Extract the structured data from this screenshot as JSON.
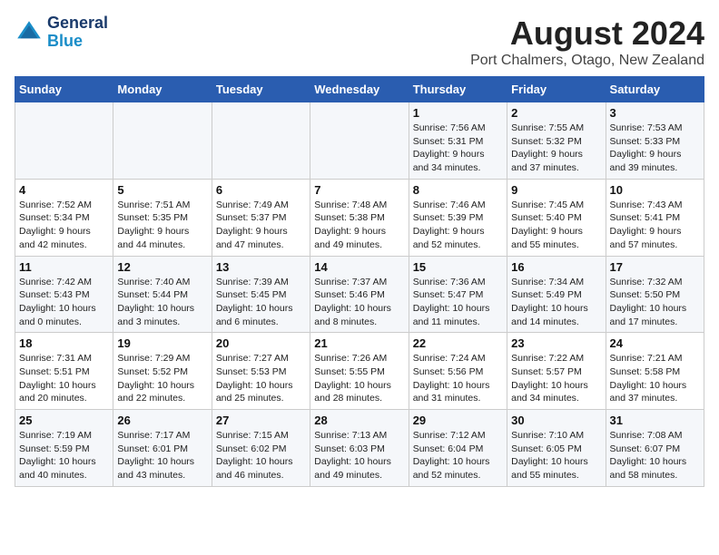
{
  "header": {
    "logo_line1": "General",
    "logo_line2": "Blue",
    "month_year": "August 2024",
    "location": "Port Chalmers, Otago, New Zealand"
  },
  "weekdays": [
    "Sunday",
    "Monday",
    "Tuesday",
    "Wednesday",
    "Thursday",
    "Friday",
    "Saturday"
  ],
  "weeks": [
    [
      {
        "day": "",
        "info": ""
      },
      {
        "day": "",
        "info": ""
      },
      {
        "day": "",
        "info": ""
      },
      {
        "day": "",
        "info": ""
      },
      {
        "day": "1",
        "info": "Sunrise: 7:56 AM\nSunset: 5:31 PM\nDaylight: 9 hours\nand 34 minutes."
      },
      {
        "day": "2",
        "info": "Sunrise: 7:55 AM\nSunset: 5:32 PM\nDaylight: 9 hours\nand 37 minutes."
      },
      {
        "day": "3",
        "info": "Sunrise: 7:53 AM\nSunset: 5:33 PM\nDaylight: 9 hours\nand 39 minutes."
      }
    ],
    [
      {
        "day": "4",
        "info": "Sunrise: 7:52 AM\nSunset: 5:34 PM\nDaylight: 9 hours\nand 42 minutes."
      },
      {
        "day": "5",
        "info": "Sunrise: 7:51 AM\nSunset: 5:35 PM\nDaylight: 9 hours\nand 44 minutes."
      },
      {
        "day": "6",
        "info": "Sunrise: 7:49 AM\nSunset: 5:37 PM\nDaylight: 9 hours\nand 47 minutes."
      },
      {
        "day": "7",
        "info": "Sunrise: 7:48 AM\nSunset: 5:38 PM\nDaylight: 9 hours\nand 49 minutes."
      },
      {
        "day": "8",
        "info": "Sunrise: 7:46 AM\nSunset: 5:39 PM\nDaylight: 9 hours\nand 52 minutes."
      },
      {
        "day": "9",
        "info": "Sunrise: 7:45 AM\nSunset: 5:40 PM\nDaylight: 9 hours\nand 55 minutes."
      },
      {
        "day": "10",
        "info": "Sunrise: 7:43 AM\nSunset: 5:41 PM\nDaylight: 9 hours\nand 57 minutes."
      }
    ],
    [
      {
        "day": "11",
        "info": "Sunrise: 7:42 AM\nSunset: 5:43 PM\nDaylight: 10 hours\nand 0 minutes."
      },
      {
        "day": "12",
        "info": "Sunrise: 7:40 AM\nSunset: 5:44 PM\nDaylight: 10 hours\nand 3 minutes."
      },
      {
        "day": "13",
        "info": "Sunrise: 7:39 AM\nSunset: 5:45 PM\nDaylight: 10 hours\nand 6 minutes."
      },
      {
        "day": "14",
        "info": "Sunrise: 7:37 AM\nSunset: 5:46 PM\nDaylight: 10 hours\nand 8 minutes."
      },
      {
        "day": "15",
        "info": "Sunrise: 7:36 AM\nSunset: 5:47 PM\nDaylight: 10 hours\nand 11 minutes."
      },
      {
        "day": "16",
        "info": "Sunrise: 7:34 AM\nSunset: 5:49 PM\nDaylight: 10 hours\nand 14 minutes."
      },
      {
        "day": "17",
        "info": "Sunrise: 7:32 AM\nSunset: 5:50 PM\nDaylight: 10 hours\nand 17 minutes."
      }
    ],
    [
      {
        "day": "18",
        "info": "Sunrise: 7:31 AM\nSunset: 5:51 PM\nDaylight: 10 hours\nand 20 minutes."
      },
      {
        "day": "19",
        "info": "Sunrise: 7:29 AM\nSunset: 5:52 PM\nDaylight: 10 hours\nand 22 minutes."
      },
      {
        "day": "20",
        "info": "Sunrise: 7:27 AM\nSunset: 5:53 PM\nDaylight: 10 hours\nand 25 minutes."
      },
      {
        "day": "21",
        "info": "Sunrise: 7:26 AM\nSunset: 5:55 PM\nDaylight: 10 hours\nand 28 minutes."
      },
      {
        "day": "22",
        "info": "Sunrise: 7:24 AM\nSunset: 5:56 PM\nDaylight: 10 hours\nand 31 minutes."
      },
      {
        "day": "23",
        "info": "Sunrise: 7:22 AM\nSunset: 5:57 PM\nDaylight: 10 hours\nand 34 minutes."
      },
      {
        "day": "24",
        "info": "Sunrise: 7:21 AM\nSunset: 5:58 PM\nDaylight: 10 hours\nand 37 minutes."
      }
    ],
    [
      {
        "day": "25",
        "info": "Sunrise: 7:19 AM\nSunset: 5:59 PM\nDaylight: 10 hours\nand 40 minutes."
      },
      {
        "day": "26",
        "info": "Sunrise: 7:17 AM\nSunset: 6:01 PM\nDaylight: 10 hours\nand 43 minutes."
      },
      {
        "day": "27",
        "info": "Sunrise: 7:15 AM\nSunset: 6:02 PM\nDaylight: 10 hours\nand 46 minutes."
      },
      {
        "day": "28",
        "info": "Sunrise: 7:13 AM\nSunset: 6:03 PM\nDaylight: 10 hours\nand 49 minutes."
      },
      {
        "day": "29",
        "info": "Sunrise: 7:12 AM\nSunset: 6:04 PM\nDaylight: 10 hours\nand 52 minutes."
      },
      {
        "day": "30",
        "info": "Sunrise: 7:10 AM\nSunset: 6:05 PM\nDaylight: 10 hours\nand 55 minutes."
      },
      {
        "day": "31",
        "info": "Sunrise: 7:08 AM\nSunset: 6:07 PM\nDaylight: 10 hours\nand 58 minutes."
      }
    ]
  ]
}
